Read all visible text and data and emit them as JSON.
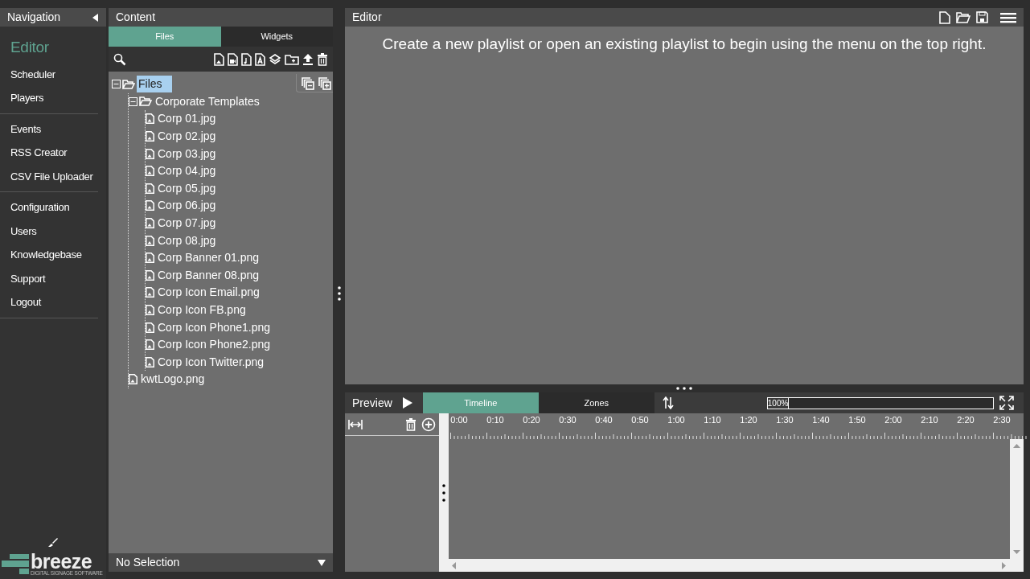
{
  "navigation": {
    "title": "Navigation",
    "sections": [
      {
        "items": [
          {
            "label": "Editor",
            "selected": true
          },
          {
            "label": "Scheduler",
            "selected": false
          },
          {
            "label": "Players",
            "selected": false
          }
        ]
      },
      {
        "items": [
          {
            "label": "Events",
            "selected": false
          },
          {
            "label": "RSS Creator",
            "selected": false
          },
          {
            "label": "CSV File Uploader",
            "selected": false
          }
        ]
      },
      {
        "items": [
          {
            "label": "Configuration",
            "selected": false
          },
          {
            "label": "Users",
            "selected": false
          },
          {
            "label": "Knowledgebase",
            "selected": false
          },
          {
            "label": "Support",
            "selected": false
          },
          {
            "label": "Logout",
            "selected": false
          }
        ]
      }
    ],
    "logo": {
      "name": "breeze",
      "tagline": "DIGITAL SIGNAGE SOFTWARE"
    }
  },
  "content": {
    "title": "Content",
    "tabs": [
      {
        "label": "Files",
        "selected": true
      },
      {
        "label": "Widgets",
        "selected": false
      }
    ],
    "tree": [
      {
        "kind": "folder",
        "label": "Files",
        "selected": true,
        "expanded": true,
        "children": [
          {
            "kind": "folder",
            "label": "Corporate Templates",
            "selected": false,
            "expanded": true,
            "children": [
              {
                "kind": "file",
                "label": "Corp 01.jpg",
                "selected": false
              },
              {
                "kind": "file",
                "label": "Corp 02.jpg",
                "selected": false
              },
              {
                "kind": "file",
                "label": "Corp 03.jpg",
                "selected": false
              },
              {
                "kind": "file",
                "label": "Corp 04.jpg",
                "selected": false
              },
              {
                "kind": "file",
                "label": "Corp 05.jpg",
                "selected": false
              },
              {
                "kind": "file",
                "label": "Corp 06.jpg",
                "selected": false
              },
              {
                "kind": "file",
                "label": "Corp 07.jpg",
                "selected": false
              },
              {
                "kind": "file",
                "label": "Corp 08.jpg",
                "selected": false
              },
              {
                "kind": "file",
                "label": "Corp Banner 01.png",
                "selected": false
              },
              {
                "kind": "file",
                "label": "Corp Banner 08.png",
                "selected": false
              },
              {
                "kind": "file",
                "label": "Corp Icon Email.png",
                "selected": false
              },
              {
                "kind": "file",
                "label": "Corp Icon FB.png",
                "selected": false
              },
              {
                "kind": "file",
                "label": "Corp Icon Phone1.png",
                "selected": false
              },
              {
                "kind": "file",
                "label": "Corp Icon Phone2.png",
                "selected": false
              },
              {
                "kind": "file",
                "label": "Corp Icon Twitter.png",
                "selected": false
              }
            ]
          },
          {
            "kind": "file",
            "label": "kwtLogo.png",
            "selected": false
          }
        ]
      }
    ],
    "status": "No Selection"
  },
  "editor": {
    "title": "Editor",
    "message": "Create a new playlist or open an existing playlist to begin using the menu on the top right."
  },
  "preview": {
    "title": "Preview",
    "tabs": [
      {
        "label": "Timeline",
        "selected": true
      },
      {
        "label": "Zones",
        "selected": false
      }
    ],
    "zoom": {
      "reading": "100%",
      "level": 0
    },
    "ticks": [
      "0:00",
      "0:10",
      "0:20",
      "0:30",
      "0:40",
      "0:50",
      "1:00",
      "1:10",
      "1:20",
      "1:30",
      "1:40",
      "1:50",
      "2:00",
      "2:10",
      "2:20",
      "2:30"
    ]
  }
}
